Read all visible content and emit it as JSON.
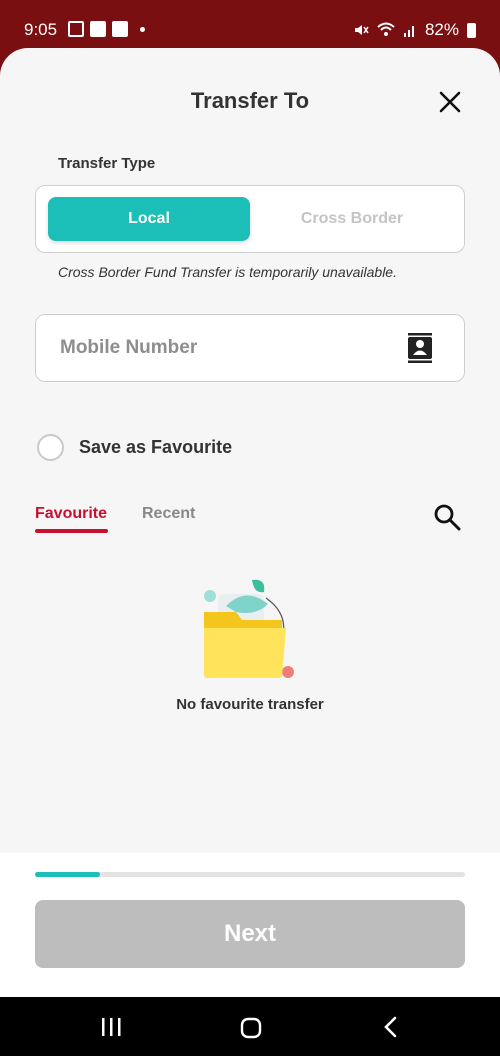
{
  "status_bar": {
    "time": "9:05",
    "battery": "82%"
  },
  "header": {
    "title": "Transfer To"
  },
  "transfer_type": {
    "label": "Transfer Type",
    "options": [
      "Local",
      "Cross Border"
    ],
    "selected": "Local",
    "note": "Cross Border Fund Transfer is temporarily unavailable."
  },
  "mobile_field": {
    "placeholder": "Mobile Number"
  },
  "save_favourite": {
    "label": "Save as Favourite",
    "checked": false
  },
  "tabs": {
    "items": [
      "Favourite",
      "Recent"
    ],
    "active": "Favourite"
  },
  "empty_state": {
    "message": "No favourite transfer"
  },
  "progress": {
    "fraction": 0.15
  },
  "footer": {
    "next_label": "Next"
  },
  "colors": {
    "accent": "#1bbfb7",
    "brand_red": "#c8102e",
    "status_bar_bg": "#7a0f12",
    "disabled_button": "#bdbdbd"
  },
  "icons": [
    "close-icon",
    "contact-book-icon",
    "search-icon",
    "folder-illustration",
    "recents-icon",
    "home-icon",
    "back-icon"
  ]
}
